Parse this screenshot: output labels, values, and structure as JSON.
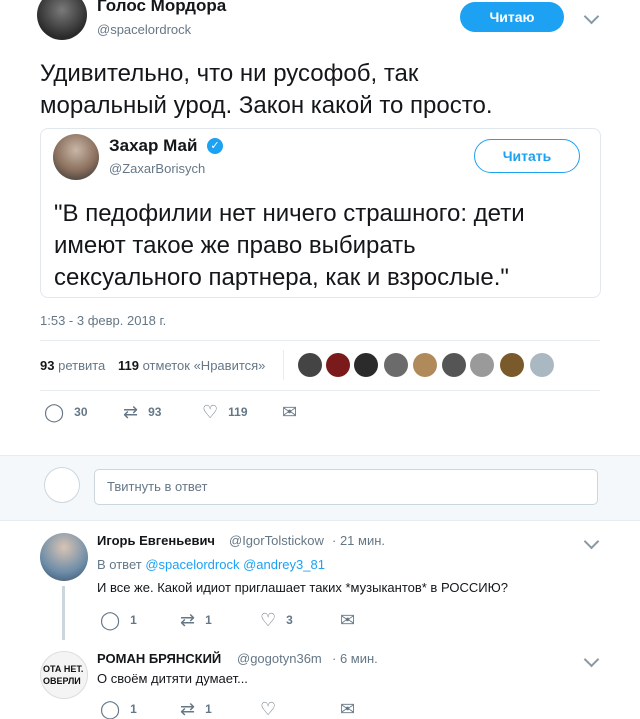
{
  "author": {
    "name": "Голос Мордора",
    "handle": "@spacelordrock",
    "follow_label": "Читаю"
  },
  "tweet": {
    "text_line1": "Удивительно, что ни русофоб, так",
    "text_line2": "моральный урод. Закон какой то просто.",
    "timestamp": "1:53 - 3 февр. 2018 г."
  },
  "quoted": {
    "name": "Захар Май",
    "handle": "@ZaxarBorisych",
    "follow_label": "Читать",
    "verified": true,
    "text_line1": "\"В педофилии нет ничего страшного: дети",
    "text_line2": "имеют такое же право выбирать",
    "text_line3": "сексуального партнера, как и взрослые.\""
  },
  "stats": {
    "retweets_count": "93",
    "retweets_label": "ретвита",
    "likes_count": "119",
    "likes_label": "отметок «Нравится»"
  },
  "actions": {
    "replies": "30",
    "retweets": "93",
    "likes": "119"
  },
  "reply_box": {
    "placeholder": "Твитнуть в ответ"
  },
  "replies": [
    {
      "name": "Игорь Евгеньевич",
      "handle": "@IgorTolstickow",
      "time": "· 21 мин.",
      "in_reply_prefix": "В ответ",
      "mention1": "@spacelordrock",
      "mention2": "@andrey3_81",
      "text": "И все же. Какой идиот приглашает таких *музыкантов* в РОССИЮ?",
      "replies": "1",
      "retweets": "1",
      "likes": "3"
    },
    {
      "name": "РОМАН БРЯНСКИЙ",
      "handle": "@gogotyn36m",
      "time": "· 6 мин.",
      "avatar_text_1": "ОТА НЕТ.",
      "avatar_text_2": "ОВЕРЛИ",
      "text": "О своём дитяти думает...",
      "replies": "1",
      "retweets": "1",
      "likes": ""
    }
  ],
  "colors": {
    "accent": "#1da1f2",
    "muted": "#657786",
    "border": "#e6ecf0",
    "verified": "#1da1f2"
  }
}
